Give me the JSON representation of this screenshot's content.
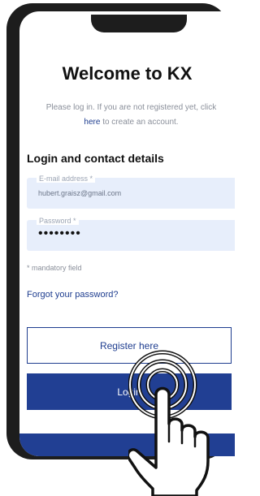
{
  "login_page": {
    "title": "Welcome to KX",
    "intro_part1": "Please log in. If you are not registered yet, click",
    "intro_link": "here",
    "intro_part2": "to create an account.",
    "section_title": "Login and contact details",
    "email_label": "E-mail address *",
    "email_value": "hubert.graisz@gmail.com",
    "password_label": "Password *",
    "password_value": "••••••••",
    "mandatory_note": "* mandatory field",
    "forgot_password": "Forgot your password?",
    "register_button": "Register here",
    "login_button": "Login"
  },
  "colors": {
    "brand_blue": "#213f93",
    "field_bg": "#e7eefb",
    "phone_frame": "#1d1d1d"
  },
  "icons": {
    "tap_gesture": "hand-tap-icon"
  }
}
